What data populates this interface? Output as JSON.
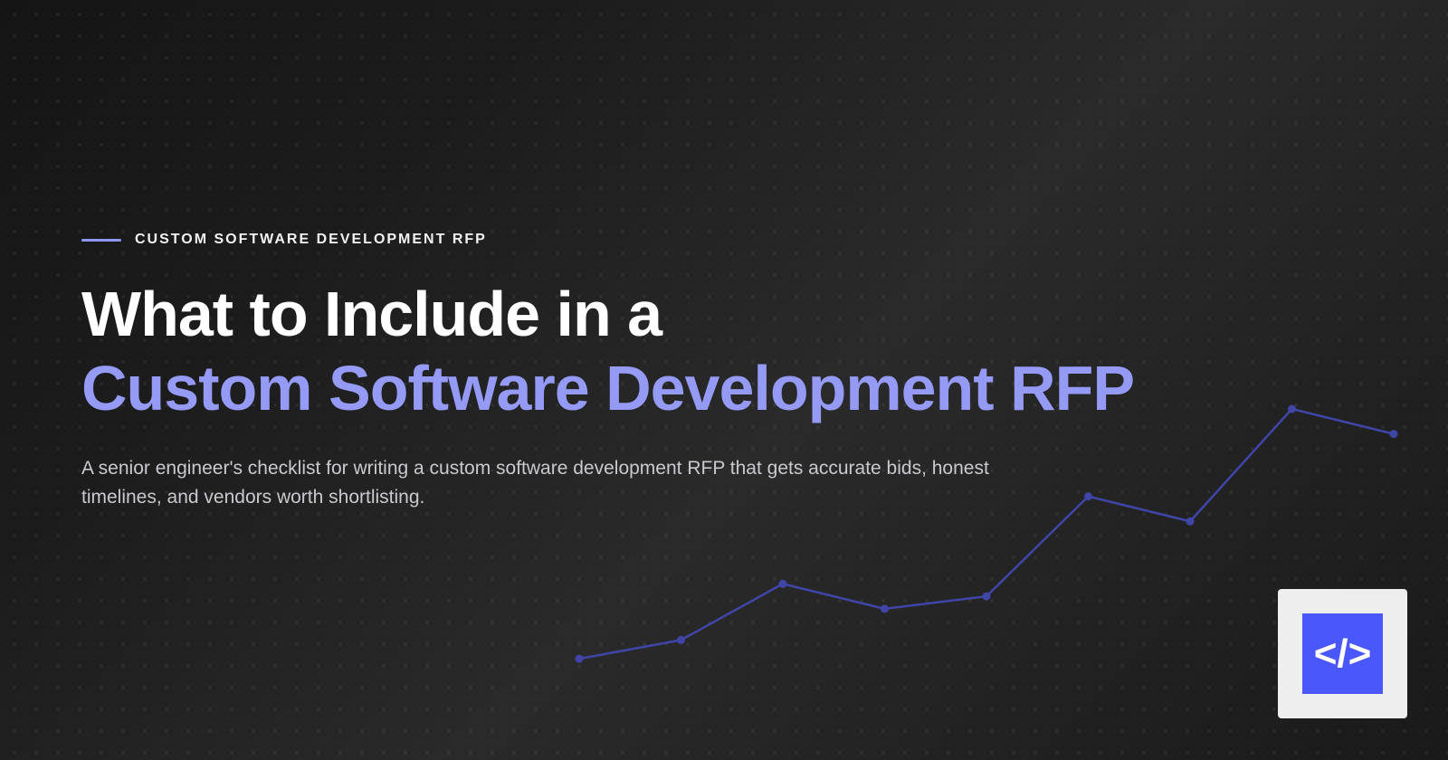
{
  "hero": {
    "eyebrow": "CUSTOM SOFTWARE DEVELOPMENT RFP",
    "title_line1": "What to Include in a",
    "title_line2": "Custom Software Development RFP",
    "subtitle": "A senior engineer's checklist for writing a custom software development RFP that gets accurate bids, honest timelines, and vendors worth shortlisting."
  },
  "logo": {
    "icon": "code-brackets-icon",
    "text": "</>"
  },
  "colors": {
    "accent": "#959bf5",
    "logo_blue": "#4a57fb",
    "line": "#3f46a8",
    "background": "#1f1f1f"
  },
  "decoration": {
    "icon": "trend-line-icon",
    "values": [
      1,
      4,
      13,
      9,
      11,
      27,
      23,
      41,
      37
    ]
  }
}
